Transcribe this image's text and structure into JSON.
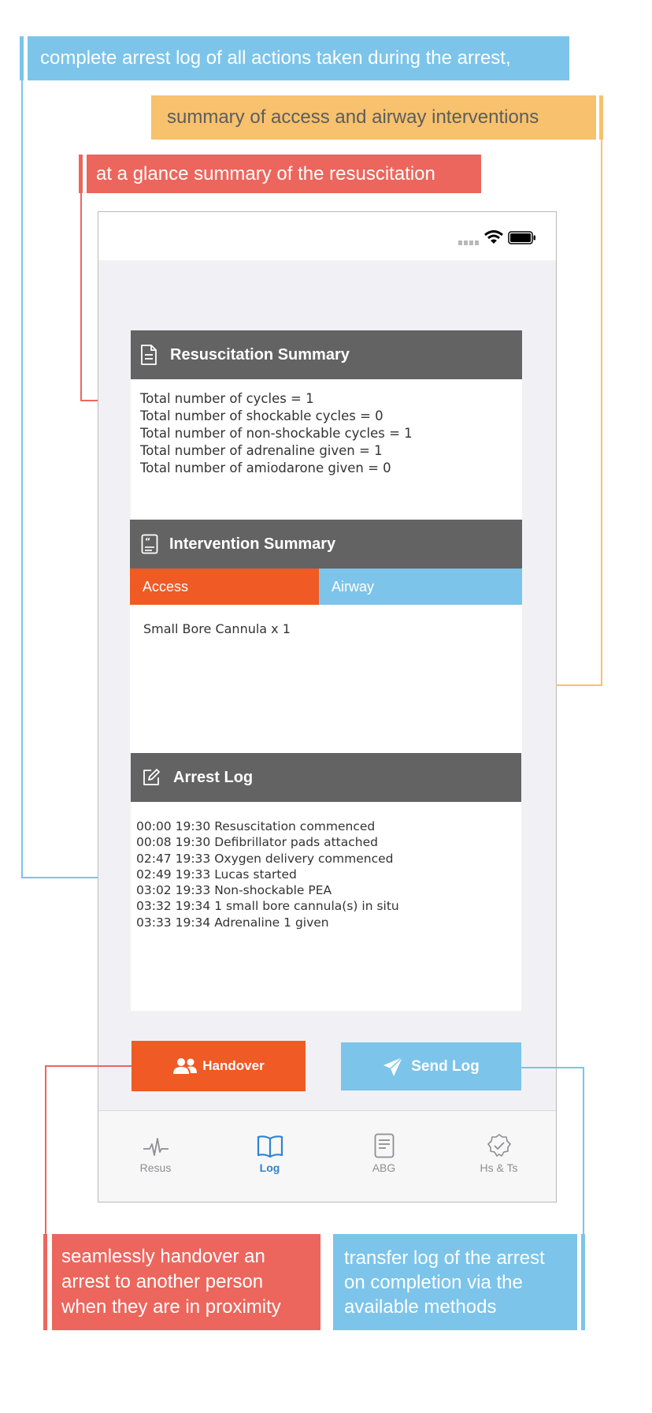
{
  "callouts": {
    "log": "complete arrest log of all actions taken during the arrest,",
    "interventions": "summary of access and airway interventions",
    "glance": "at a glance summary of the resuscitation",
    "handover": "seamlessly handover an arrest to another person when they are in proximity",
    "send": "transfer log of the arrest on completion via the available methods"
  },
  "resuscitation_summary": {
    "title": "Resuscitation Summary",
    "lines": [
      "Total number of cycles = 1",
      "Total number of shockable cycles = 0",
      "Total number of non-shockable cycles = 1",
      "Total number of adrenaline given = 1",
      "Total number of amiodarone given = 0"
    ]
  },
  "intervention_summary": {
    "title": "Intervention Summary",
    "tabs": [
      "Access",
      "Airway"
    ],
    "selected_tab": "Access",
    "items": [
      "Small Bore Cannula x 1"
    ]
  },
  "arrest_log": {
    "title": "Arrest Log",
    "entries": [
      "00:00 19:30 Resuscitation commenced",
      "00:08 19:30 Defibrillator pads attached",
      "02:47 19:33 Oxygen delivery commenced",
      "02:49 19:33 Lucas started",
      "03:02 19:33 Non-shockable PEA",
      "03:32 19:34 1 small bore cannula(s) in situ",
      "03:33 19:34 Adrenaline 1 given"
    ]
  },
  "buttons": {
    "handover": "Handover",
    "send_log": "Send Log"
  },
  "tabbar": {
    "items": [
      "Resus",
      "Log",
      "ABG",
      "Hs & Ts"
    ],
    "active": "Log"
  },
  "colors": {
    "orange": "#F05A24",
    "blue": "#7CC4EA",
    "callout_red": "#EC665D",
    "callout_orange": "#F7C16E",
    "header_gray": "#636363",
    "tab_active": "#2F82CF"
  },
  "icons": {
    "status": [
      "signal-dots-icon",
      "wifi-icon",
      "battery-icon"
    ],
    "resuscitation_header": "document-icon",
    "intervention_header": "quote-document-icon",
    "log_header": "edit-icon",
    "handover_button": "people-icon",
    "send_button": "paper-plane-icon",
    "tabs": [
      "pulse-icon",
      "book-icon",
      "notes-icon",
      "badge-check-icon"
    ]
  }
}
